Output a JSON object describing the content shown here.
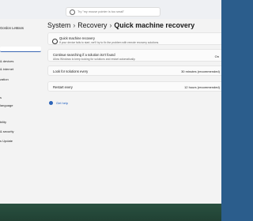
{
  "search": {
    "placeholder": "Try \"my mouse pointer is too small\""
  },
  "user": {
    "name": "Gordon LeMans"
  },
  "sidebar": {
    "items": [
      {
        "label": "& devices"
      },
      {
        "label": "& internet"
      },
      {
        "label": "zation"
      },
      {
        "label": ""
      },
      {
        "label": "s"
      },
      {
        "label": "language"
      },
      {
        "label": ""
      },
      {
        "label": "bility"
      },
      {
        "label": "& security"
      },
      {
        "label": "s Update"
      }
    ]
  },
  "breadcrumb": {
    "item1": "System",
    "item2": "Recovery",
    "current": "Quick machine recovery"
  },
  "settings": {
    "qmr": {
      "title": "Quick machine recovery",
      "desc": "If your device fails to start, we'll try to fix the problem with remote recovery solutions."
    },
    "continue_searching": {
      "title": "Continue searching if a solution isn't found",
      "desc": "Allow Windows to keep looking for solutions and restart automatically.",
      "value": "On"
    },
    "look_for_solutions": {
      "title": "Look for solutions every",
      "value": "30 minutes (recommended)"
    },
    "restart_every": {
      "title": "Restart every",
      "value": "12 hours (recommended)"
    }
  },
  "help": {
    "label": "Get help"
  }
}
